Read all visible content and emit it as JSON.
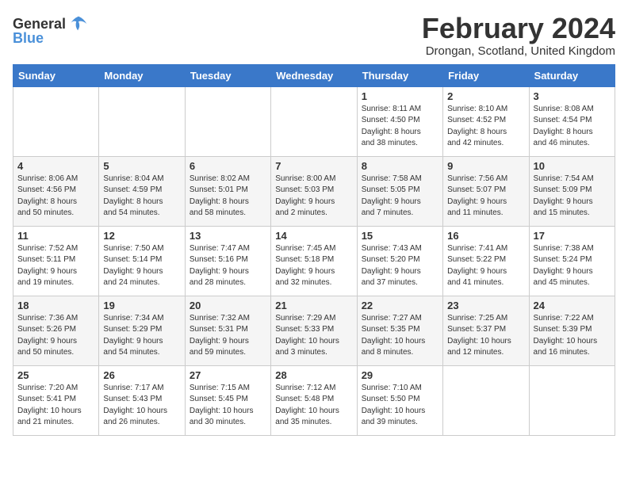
{
  "logo": {
    "text_general": "General",
    "text_blue": "Blue"
  },
  "header": {
    "month_year": "February 2024",
    "location": "Drongan, Scotland, United Kingdom"
  },
  "weekdays": [
    "Sunday",
    "Monday",
    "Tuesday",
    "Wednesday",
    "Thursday",
    "Friday",
    "Saturday"
  ],
  "weeks": [
    [
      {
        "day": "",
        "info": ""
      },
      {
        "day": "",
        "info": ""
      },
      {
        "day": "",
        "info": ""
      },
      {
        "day": "",
        "info": ""
      },
      {
        "day": "1",
        "info": "Sunrise: 8:11 AM\nSunset: 4:50 PM\nDaylight: 8 hours\nand 38 minutes."
      },
      {
        "day": "2",
        "info": "Sunrise: 8:10 AM\nSunset: 4:52 PM\nDaylight: 8 hours\nand 42 minutes."
      },
      {
        "day": "3",
        "info": "Sunrise: 8:08 AM\nSunset: 4:54 PM\nDaylight: 8 hours\nand 46 minutes."
      }
    ],
    [
      {
        "day": "4",
        "info": "Sunrise: 8:06 AM\nSunset: 4:56 PM\nDaylight: 8 hours\nand 50 minutes."
      },
      {
        "day": "5",
        "info": "Sunrise: 8:04 AM\nSunset: 4:59 PM\nDaylight: 8 hours\nand 54 minutes."
      },
      {
        "day": "6",
        "info": "Sunrise: 8:02 AM\nSunset: 5:01 PM\nDaylight: 8 hours\nand 58 minutes."
      },
      {
        "day": "7",
        "info": "Sunrise: 8:00 AM\nSunset: 5:03 PM\nDaylight: 9 hours\nand 2 minutes."
      },
      {
        "day": "8",
        "info": "Sunrise: 7:58 AM\nSunset: 5:05 PM\nDaylight: 9 hours\nand 7 minutes."
      },
      {
        "day": "9",
        "info": "Sunrise: 7:56 AM\nSunset: 5:07 PM\nDaylight: 9 hours\nand 11 minutes."
      },
      {
        "day": "10",
        "info": "Sunrise: 7:54 AM\nSunset: 5:09 PM\nDaylight: 9 hours\nand 15 minutes."
      }
    ],
    [
      {
        "day": "11",
        "info": "Sunrise: 7:52 AM\nSunset: 5:11 PM\nDaylight: 9 hours\nand 19 minutes."
      },
      {
        "day": "12",
        "info": "Sunrise: 7:50 AM\nSunset: 5:14 PM\nDaylight: 9 hours\nand 24 minutes."
      },
      {
        "day": "13",
        "info": "Sunrise: 7:47 AM\nSunset: 5:16 PM\nDaylight: 9 hours\nand 28 minutes."
      },
      {
        "day": "14",
        "info": "Sunrise: 7:45 AM\nSunset: 5:18 PM\nDaylight: 9 hours\nand 32 minutes."
      },
      {
        "day": "15",
        "info": "Sunrise: 7:43 AM\nSunset: 5:20 PM\nDaylight: 9 hours\nand 37 minutes."
      },
      {
        "day": "16",
        "info": "Sunrise: 7:41 AM\nSunset: 5:22 PM\nDaylight: 9 hours\nand 41 minutes."
      },
      {
        "day": "17",
        "info": "Sunrise: 7:38 AM\nSunset: 5:24 PM\nDaylight: 9 hours\nand 45 minutes."
      }
    ],
    [
      {
        "day": "18",
        "info": "Sunrise: 7:36 AM\nSunset: 5:26 PM\nDaylight: 9 hours\nand 50 minutes."
      },
      {
        "day": "19",
        "info": "Sunrise: 7:34 AM\nSunset: 5:29 PM\nDaylight: 9 hours\nand 54 minutes."
      },
      {
        "day": "20",
        "info": "Sunrise: 7:32 AM\nSunset: 5:31 PM\nDaylight: 9 hours\nand 59 minutes."
      },
      {
        "day": "21",
        "info": "Sunrise: 7:29 AM\nSunset: 5:33 PM\nDaylight: 10 hours\nand 3 minutes."
      },
      {
        "day": "22",
        "info": "Sunrise: 7:27 AM\nSunset: 5:35 PM\nDaylight: 10 hours\nand 8 minutes."
      },
      {
        "day": "23",
        "info": "Sunrise: 7:25 AM\nSunset: 5:37 PM\nDaylight: 10 hours\nand 12 minutes."
      },
      {
        "day": "24",
        "info": "Sunrise: 7:22 AM\nSunset: 5:39 PM\nDaylight: 10 hours\nand 16 minutes."
      }
    ],
    [
      {
        "day": "25",
        "info": "Sunrise: 7:20 AM\nSunset: 5:41 PM\nDaylight: 10 hours\nand 21 minutes."
      },
      {
        "day": "26",
        "info": "Sunrise: 7:17 AM\nSunset: 5:43 PM\nDaylight: 10 hours\nand 26 minutes."
      },
      {
        "day": "27",
        "info": "Sunrise: 7:15 AM\nSunset: 5:45 PM\nDaylight: 10 hours\nand 30 minutes."
      },
      {
        "day": "28",
        "info": "Sunrise: 7:12 AM\nSunset: 5:48 PM\nDaylight: 10 hours\nand 35 minutes."
      },
      {
        "day": "29",
        "info": "Sunrise: 7:10 AM\nSunset: 5:50 PM\nDaylight: 10 hours\nand 39 minutes."
      },
      {
        "day": "",
        "info": ""
      },
      {
        "day": "",
        "info": ""
      }
    ]
  ]
}
